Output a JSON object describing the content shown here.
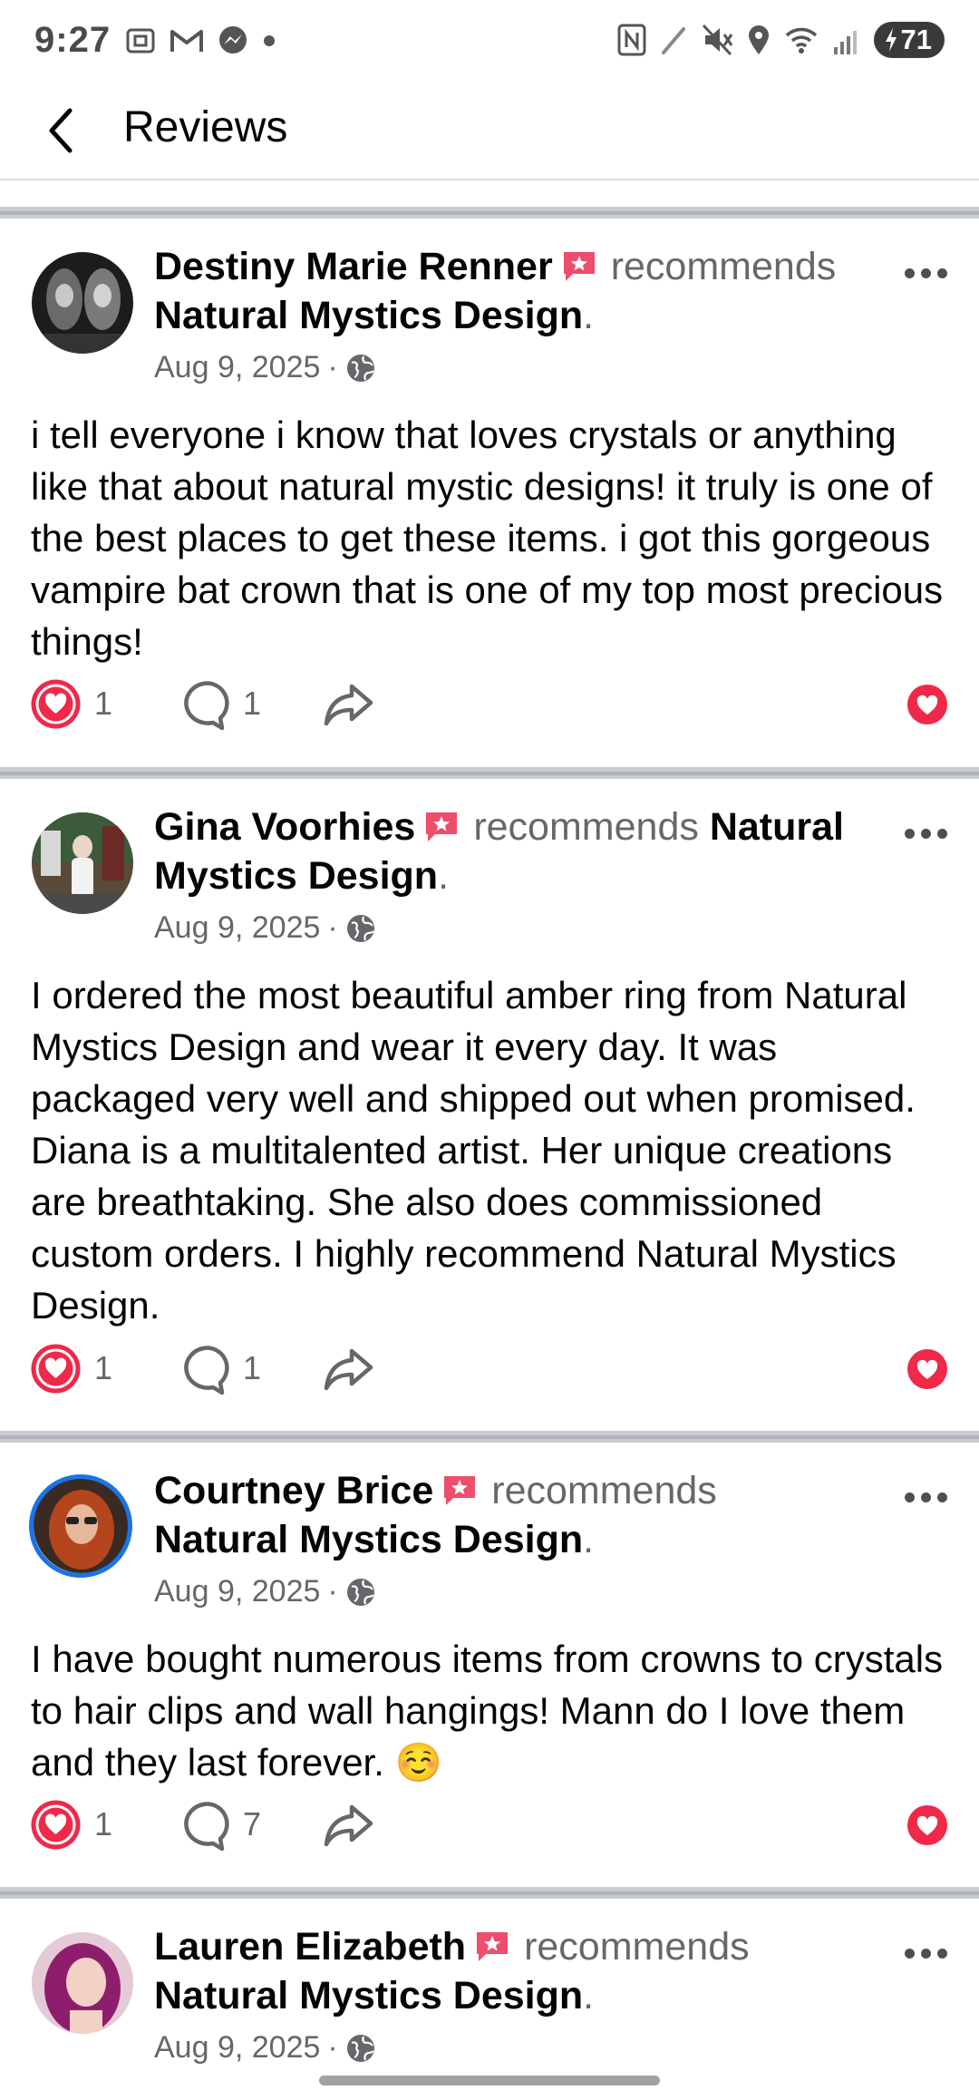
{
  "status_bar": {
    "time": "9:27",
    "left_icons": [
      "screenshot-icon",
      "gmail-icon",
      "messenger-icon",
      "dot-icon"
    ],
    "right_icons": [
      "nfc-icon",
      "pen-icon",
      "mute-icon",
      "location-icon",
      "wifi-icon",
      "signal-icon"
    ],
    "battery": "71"
  },
  "header": {
    "title": "Reviews"
  },
  "colors": {
    "like_red": "#f0284a",
    "badge_pink": "#ee4d6b",
    "ring_blue": "#1b74e4",
    "secondary_text": "#65676b"
  },
  "reviews": [
    {
      "name": "Destiny Marie Renner",
      "verb": "recommends",
      "page": "Natural Mystics Design",
      "date": "Aug 9, 2025",
      "audience_sep": "·",
      "text": "i tell everyone i know that loves  crystals or anything like that about natural mystic designs! it truly is one of the best places to get these items. i got this gorgeous vampire bat  crown that is one of my top  most precious things!",
      "likes": "1",
      "comments": "1"
    },
    {
      "name": "Gina Voorhies",
      "verb": "recommends",
      "page": "Natural Mystics Design",
      "date": "Aug 9, 2025",
      "audience_sep": "·",
      "text": "I ordered the most beautiful amber ring from Natural Mystics Design and wear it every day. It was packaged very well and shipped out when promised. Diana is a multitalented artist. Her unique creations are breathtaking. She also does commissioned custom orders. I highly recommend Natural Mystics Design.",
      "likes": "1",
      "comments": "1"
    },
    {
      "name": "Courtney Brice",
      "verb": "recommends",
      "page": "Natural Mystics Design",
      "date": "Aug 9, 2025",
      "audience_sep": "·",
      "text": "I have bought numerous items from crowns to crystals to hair clips and wall hangings! Mann do I love them and they last forever. ☺️",
      "likes": "1",
      "comments": "7"
    },
    {
      "name": "Lauren Elizabeth",
      "verb": "recommends",
      "page": "Natural Mystics Design",
      "date": "Aug 9, 2025",
      "audience_sep": "·"
    }
  ]
}
